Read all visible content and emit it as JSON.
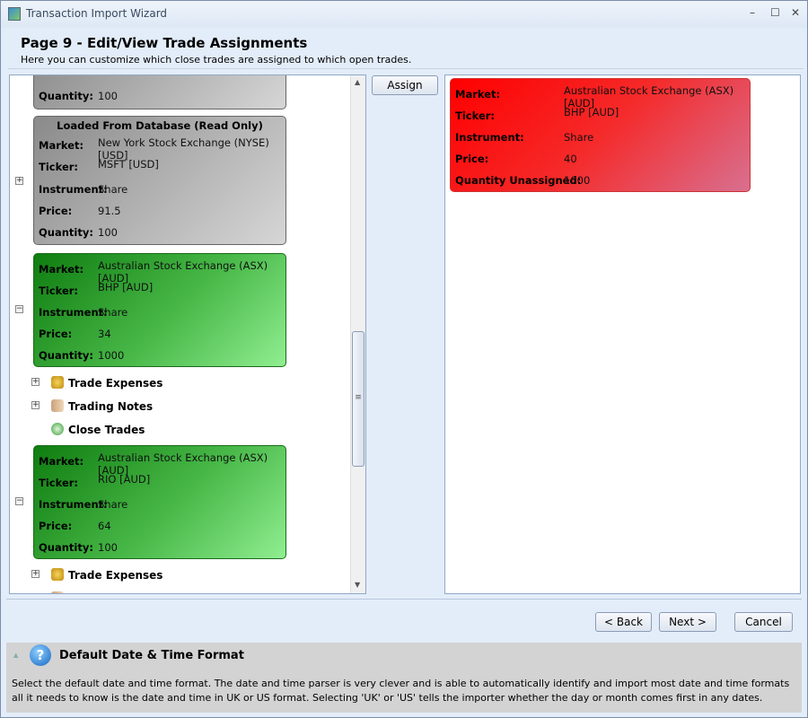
{
  "window": {
    "title": "Transaction Import Wizard",
    "controls": {
      "minimize": "–",
      "maximize": "☐",
      "close": "✕"
    }
  },
  "header": {
    "title": "Page 9 - Edit/View Trade Assignments",
    "subtitle": "Here you can customize which close trades are assigned to which open trades."
  },
  "labels": {
    "market": "Market:",
    "ticker": "Ticker:",
    "instrument": "Instrument:",
    "price": "Price:",
    "quantity": "Quantity:",
    "quantity_unassigned": "Quantity Unassigned:"
  },
  "open_trades": [
    {
      "quantity": "100",
      "style": "gray"
    },
    {
      "header": "Loaded From Database (Read Only)",
      "market": "New York Stock Exchange (NYSE) [USD]",
      "ticker": "MSFT [USD]",
      "instrument": "Share",
      "price": "91.5",
      "quantity": "100",
      "style": "gray"
    },
    {
      "market": "Australian Stock Exchange (ASX) [AUD]",
      "ticker": "BHP [AUD]",
      "instrument": "Share",
      "price": "34",
      "quantity": "1000",
      "style": "green",
      "children": [
        "Trade Expenses",
        "Trading Notes",
        "Close Trades"
      ]
    },
    {
      "market": "Australian Stock Exchange (ASX) [AUD]",
      "ticker": "RIO [AUD]",
      "instrument": "Share",
      "price": "64",
      "quantity": "100",
      "style": "green",
      "children": [
        "Trade Expenses"
      ]
    }
  ],
  "assign_label": "Assign",
  "close_trade": {
    "market": "Australian Stock Exchange (ASX) [AUD]",
    "ticker": "BHP [AUD]",
    "instrument": "Share",
    "price": "40",
    "quantity_unassigned": "1000"
  },
  "buttons": {
    "back": "< Back",
    "next": "Next >",
    "cancel": "Cancel"
  },
  "help": {
    "title": "Default Date & Time Format",
    "text": "Select the default date and time format. The date and time parser is very clever and is able to automatically identify and import most date and time formats all it needs to know is the date and time in UK or US format. Selecting 'UK' or 'US' tells the importer whether the day or month comes first in any dates."
  },
  "colors": {
    "open_trade_db": "#a0a0a0",
    "open_trade": "#2e9e2e",
    "close_trade": "#ff1a1a"
  }
}
